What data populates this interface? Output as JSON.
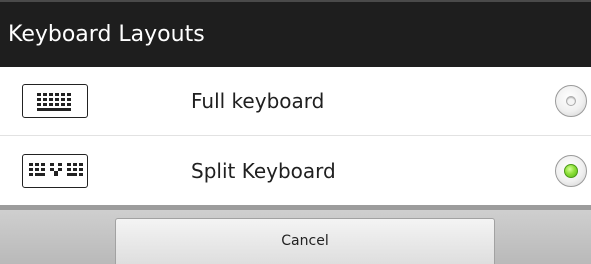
{
  "dialog": {
    "title": "Keyboard Layouts",
    "options": [
      {
        "label": "Full keyboard",
        "icon": "full-keyboard-icon",
        "selected": false
      },
      {
        "label": "Split Keyboard",
        "icon": "split-keyboard-icon",
        "selected": true
      }
    ],
    "cancel_label": "Cancel"
  },
  "colors": {
    "title_bar_bg": "#1e1e1e",
    "selected_radio": "#8fe03a",
    "footer_bg": "#c4c4c4"
  }
}
